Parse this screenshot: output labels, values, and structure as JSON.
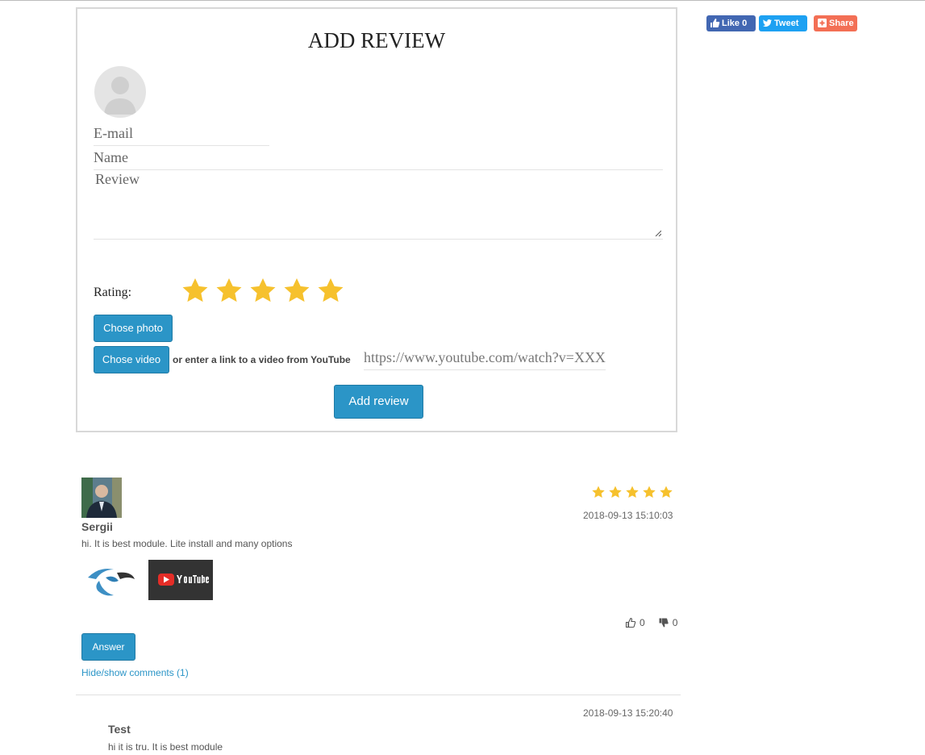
{
  "form": {
    "title": "ADD REVIEW",
    "email_placeholder": "E-mail",
    "name_placeholder": "Name",
    "review_placeholder": "Review",
    "rating_label": "Rating:",
    "rating_value": 5,
    "rating_max": 5,
    "photo_button": "Chose photo",
    "video_button": "Chose video",
    "video_or_text": "or enter a link to a video from YouTube",
    "video_link_placeholder": "https://www.youtube.com/watch?v=XXX",
    "submit_button": "Add review"
  },
  "social": {
    "like_label": "Like 0",
    "tweet_label": "Tweet",
    "share_label": "Share"
  },
  "reviews": [
    {
      "author": "Sergii",
      "text": "hi. It is best module. Lite install and many options",
      "rating": 5,
      "date": "2018-09-13 15:10:03",
      "likes": "0",
      "dislikes": "0",
      "answer_button": "Answer",
      "toggle_comments": "Hide/show comments (1)",
      "attachments": [
        "logo-image",
        "youtube-video-thumbnail"
      ]
    }
  ],
  "comments": [
    {
      "author": "Test",
      "text": "hi it is tru. It is best module",
      "date": "2018-09-13 15:20:40"
    }
  ],
  "colors": {
    "accent": "#2b95c7",
    "star": "#f6c12d",
    "facebook": "#4267b2",
    "twitter": "#1da1f2",
    "share": "#f36f55"
  },
  "icons": [
    "user-placeholder-icon",
    "star-icon",
    "thumbs-up-icon",
    "thumbs-down-icon",
    "facebook-like-icon",
    "twitter-icon",
    "plus-share-icon",
    "youtube-icon"
  ]
}
